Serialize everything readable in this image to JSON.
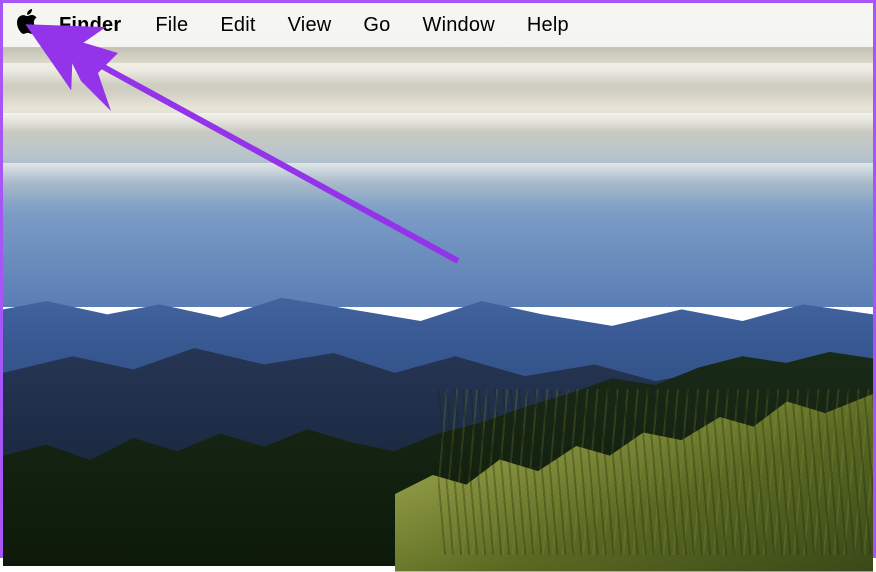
{
  "menubar": {
    "app_name": "Finder",
    "items": [
      {
        "label": "File"
      },
      {
        "label": "Edit"
      },
      {
        "label": "View"
      },
      {
        "label": "Go"
      },
      {
        "label": "Window"
      },
      {
        "label": "Help"
      }
    ]
  },
  "annotation": {
    "border_color": "#a855f7",
    "arrow_color": "#9333ea"
  }
}
